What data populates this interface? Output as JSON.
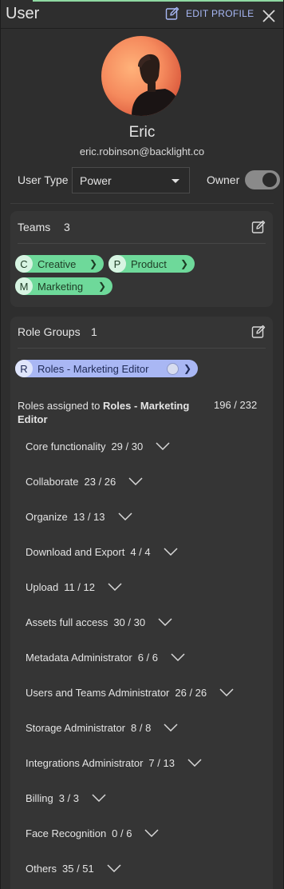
{
  "header": {
    "title": "User",
    "edit_profile": "EDIT PROFILE"
  },
  "profile": {
    "name": "Eric",
    "email": "eric.robinson@backlight.co",
    "user_type_label": "User Type",
    "user_type_value": "Power",
    "owner_label": "Owner",
    "owner_enabled": true
  },
  "teams": {
    "title": "Teams",
    "count": "3",
    "chips": [
      {
        "letter": "C",
        "label": "Creative"
      },
      {
        "letter": "P",
        "label": "Product"
      },
      {
        "letter": "M",
        "label": "Marketing"
      }
    ]
  },
  "role_groups": {
    "title": "Role Groups",
    "count": "1",
    "chip": {
      "letter": "R",
      "label": "Roles - Marketing Editor"
    },
    "assigned_prefix": "Roles assigned to ",
    "assigned_name": "Roles - Marketing Editor",
    "assigned_total": "196 / 232",
    "roles": [
      {
        "name": "Core functionality",
        "count": "29 / 30"
      },
      {
        "name": "Collaborate",
        "count": "23 / 26"
      },
      {
        "name": "Organize",
        "count": "13 / 13"
      },
      {
        "name": "Download and Export",
        "count": "4 / 4"
      },
      {
        "name": "Upload",
        "count": "11 / 12"
      },
      {
        "name": "Assets full access",
        "count": "30 / 30"
      },
      {
        "name": "Metadata Administrator",
        "count": "6 / 6"
      },
      {
        "name": "Users and Teams Administrator",
        "count": "26 / 26"
      },
      {
        "name": "Storage Administrator",
        "count": "8 / 8"
      },
      {
        "name": "Integrations Administrator",
        "count": "7 / 13"
      },
      {
        "name": "Billing",
        "count": "3 / 3"
      },
      {
        "name": "Face Recognition",
        "count": "0 / 6"
      },
      {
        "name": "Others",
        "count": "35 / 51"
      }
    ]
  },
  "colors": {
    "accent": "#a8b8f5",
    "team_chip": "#6ed99a",
    "role_chip": "#a9b7f4",
    "background": "#2e2e2e"
  }
}
